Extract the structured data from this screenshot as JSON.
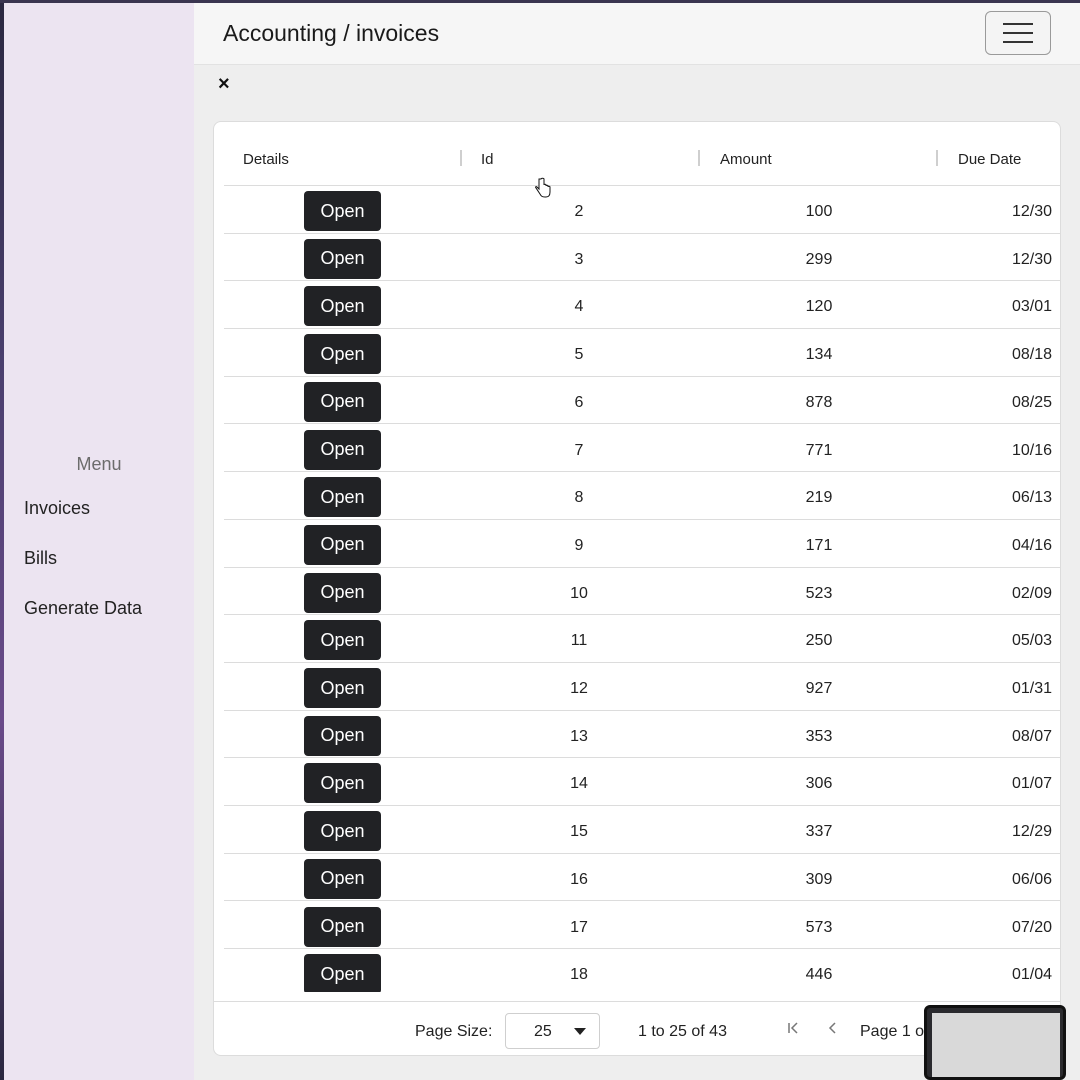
{
  "sidebar": {
    "menu_title": "Menu",
    "items": [
      {
        "label": "Invoices"
      },
      {
        "label": "Bills"
      },
      {
        "label": "Generate Data"
      }
    ]
  },
  "topbar": {
    "title": "Accounting / invoices",
    "menu_icon": "hamburger-menu-icon"
  },
  "close_icon": "close-icon",
  "close_glyph": "×",
  "grid": {
    "columns": [
      {
        "label": "Details"
      },
      {
        "label": "Id"
      },
      {
        "label": "Amount"
      },
      {
        "label": "Due Date"
      }
    ],
    "open_label": "Open",
    "rows": [
      {
        "id": "2",
        "amount": "100",
        "due": "12/30"
      },
      {
        "id": "3",
        "amount": "299",
        "due": "12/30"
      },
      {
        "id": "4",
        "amount": "120",
        "due": "03/01"
      },
      {
        "id": "5",
        "amount": "134",
        "due": "08/18"
      },
      {
        "id": "6",
        "amount": "878",
        "due": "08/25"
      },
      {
        "id": "7",
        "amount": "771",
        "due": "10/16"
      },
      {
        "id": "8",
        "amount": "219",
        "due": "06/13"
      },
      {
        "id": "9",
        "amount": "171",
        "due": "04/16"
      },
      {
        "id": "10",
        "amount": "523",
        "due": "02/09"
      },
      {
        "id": "11",
        "amount": "250",
        "due": "05/03"
      },
      {
        "id": "12",
        "amount": "927",
        "due": "01/31"
      },
      {
        "id": "13",
        "amount": "353",
        "due": "08/07"
      },
      {
        "id": "14",
        "amount": "306",
        "due": "01/07"
      },
      {
        "id": "15",
        "amount": "337",
        "due": "12/29"
      },
      {
        "id": "16",
        "amount": "309",
        "due": "06/06"
      },
      {
        "id": "17",
        "amount": "573",
        "due": "07/20"
      },
      {
        "id": "18",
        "amount": "446",
        "due": "01/04"
      }
    ],
    "footer": {
      "page_size_label": "Page Size:",
      "page_size_value": "25",
      "range_text": "1 to 25 of 43",
      "page_text": "Page 1 o"
    }
  },
  "colors": {
    "sidebar_bg": "#ece4f1",
    "button_bg": "#212225",
    "main_bg": "#eeeeee"
  }
}
